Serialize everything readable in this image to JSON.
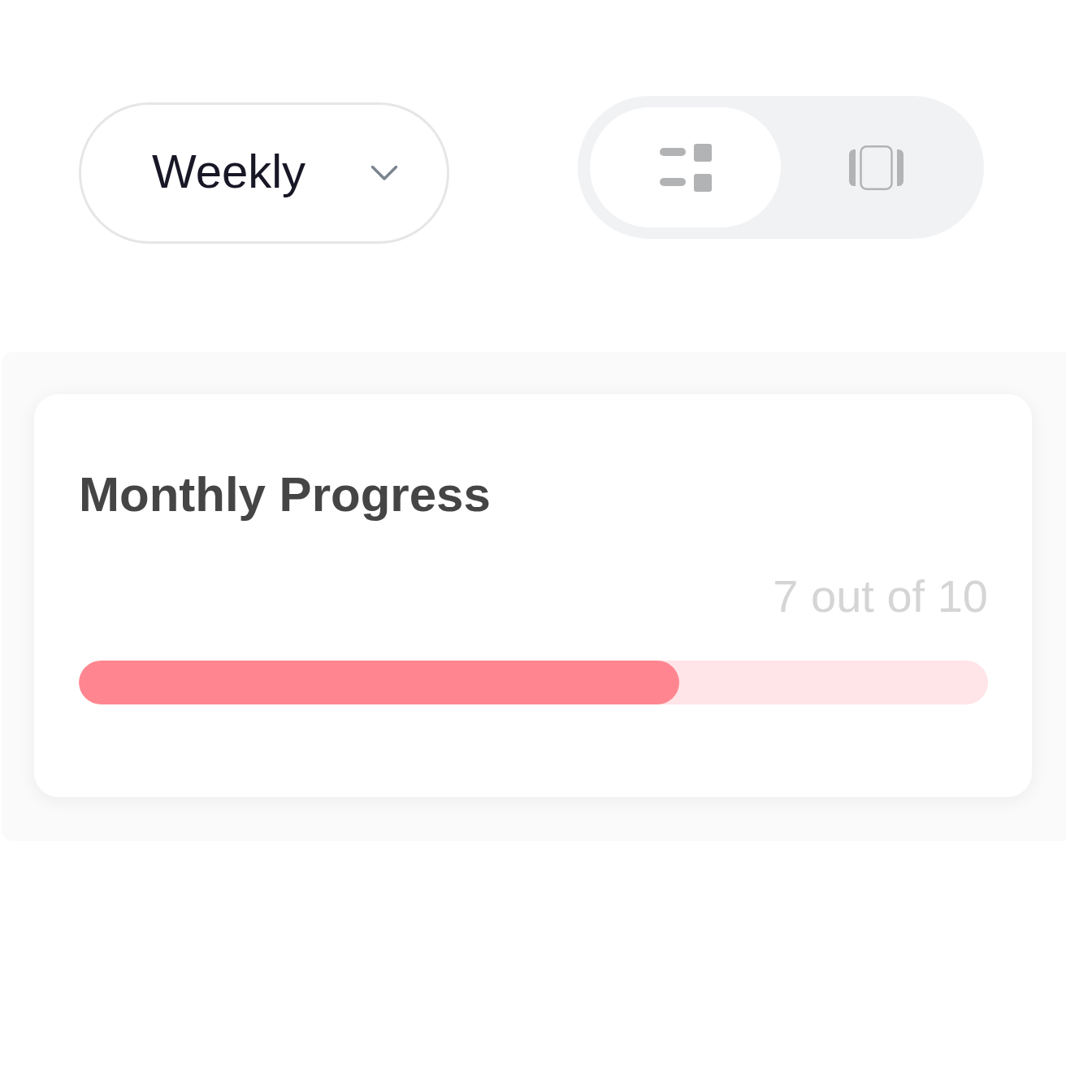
{
  "period_dropdown": {
    "value": "Weekly"
  },
  "view_toggle": [
    {
      "kind": "list",
      "selected": true
    },
    {
      "kind": "carousel",
      "selected": false
    }
  ],
  "progress_card": {
    "title": "Monthly Progress",
    "reading": "7 out of 10",
    "level": 0.66
  }
}
